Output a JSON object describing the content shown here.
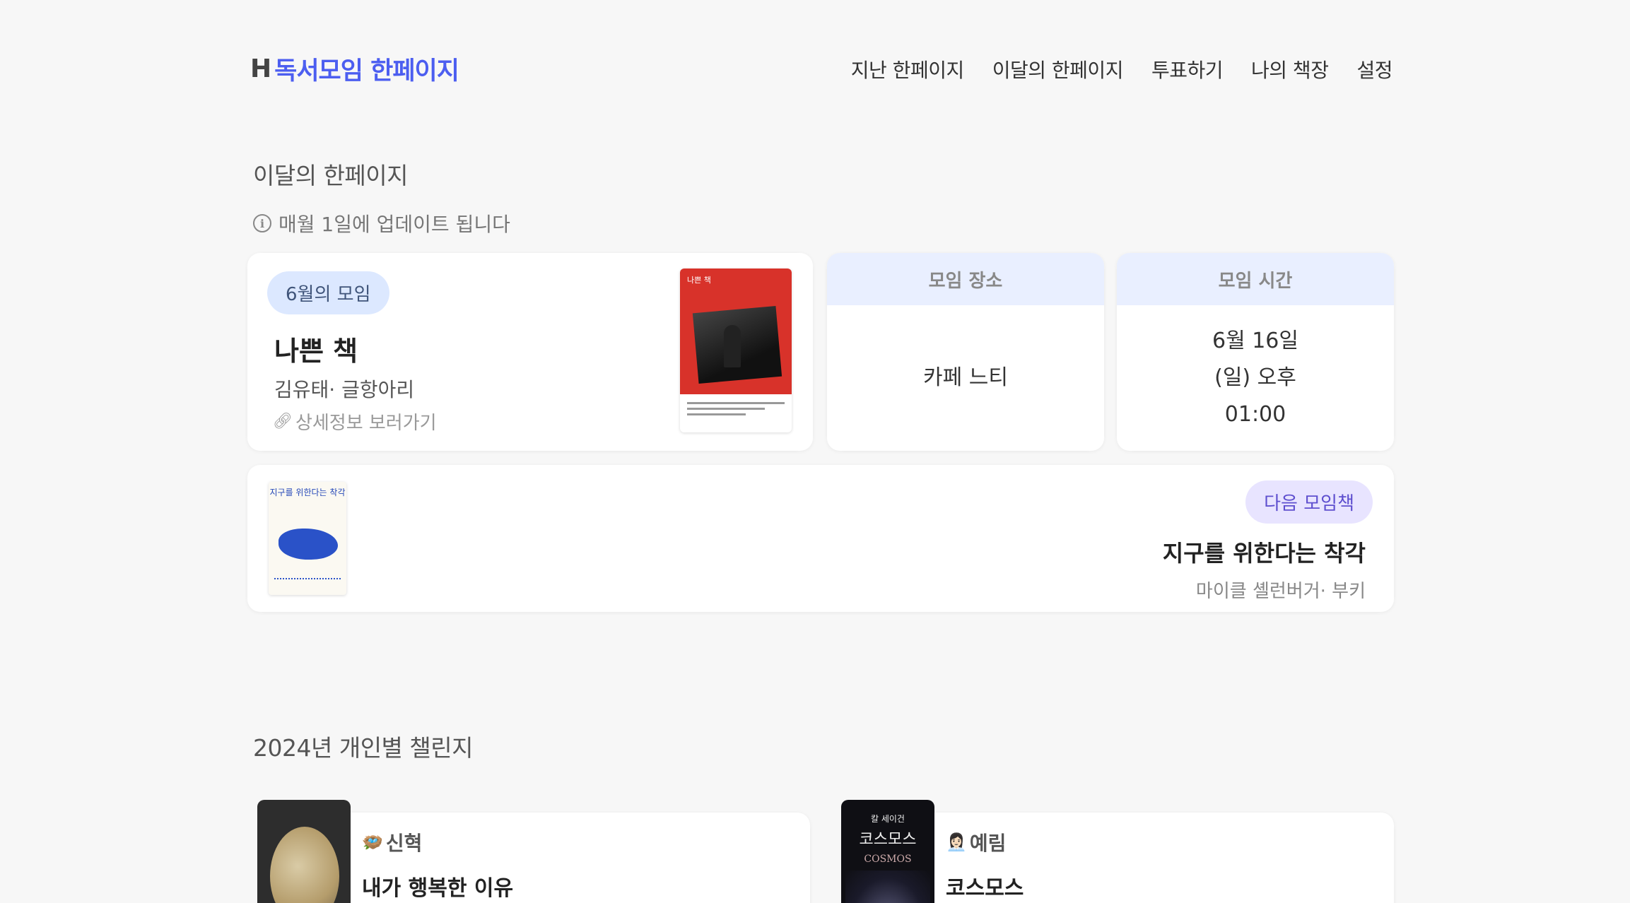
{
  "header": {
    "logo_mark": "H",
    "logo_text": "독서모임 한페이지",
    "nav": [
      "지난 한페이지",
      "이달의 한페이지",
      "투표하기",
      "나의 책장",
      "설정"
    ]
  },
  "monthly": {
    "title": "이달의 한페이지",
    "notice": "매월 1일에 업데이트 됩니다",
    "meeting": {
      "badge": "6월의 모임",
      "book_title": "나쁜 책",
      "author": "김유태· 글항아리",
      "detail_link": "상세정보 보러가기",
      "cover_title": "나쁜 책"
    },
    "place": {
      "label": "모임 장소",
      "value": "카페 느티"
    },
    "time": {
      "label": "모임 시간",
      "line1": "6월 16일",
      "line2": "(일) 오후",
      "line3": "01:00"
    },
    "next": {
      "badge": "다음 모임책",
      "book_title": "지구를 위한다는 착각",
      "author": "마이클 셸런버거· 부키",
      "cover_title": "지구를 위한다는 착각"
    }
  },
  "challenge": {
    "title": "2024년 개인별 챌린지",
    "items": [
      {
        "emoji": "🪺",
        "name": "신혁",
        "book": "내가 행복한 이유"
      },
      {
        "emoji": "👩🏻‍💼",
        "name": "예림",
        "book": "코스모스"
      }
    ],
    "cover4_author": "칼 세이건",
    "cover4_title": "코스모스",
    "cover4_en": "COSMOS"
  },
  "colors": {
    "brand": "#4c5ef0",
    "info_head_bg": "#e9efff",
    "pill_blue": "#dce8ff",
    "pill_purple": "#e8e4ff"
  }
}
